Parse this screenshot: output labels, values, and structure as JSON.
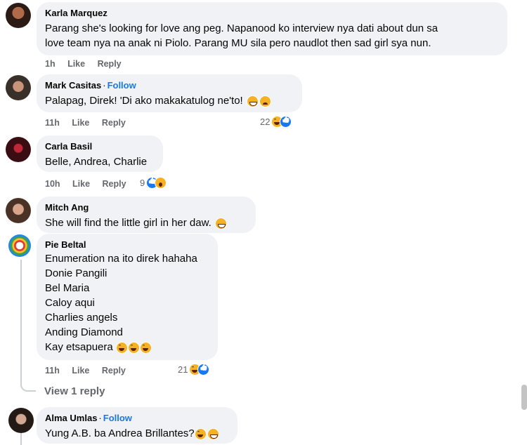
{
  "comments": [
    {
      "author": "Karla Marquez",
      "follow": "",
      "lines": [
        "Parang she's looking for love ang peg. Napanood ko interview nya dati about dun sa",
        "love team nya na anak ni Piolo. Parang MU sila pero naudlot then sad girl sya nun."
      ],
      "time": "1h",
      "like": "Like",
      "reply": "Reply",
      "reaction_count": ""
    },
    {
      "author": "Mark Casitas",
      "follow": "Follow",
      "lines": [
        "Palapag, Direk! 'Di ako makakatulog ne'to!"
      ],
      "time": "11h",
      "like": "Like",
      "reply": "Reply",
      "reaction_count": "22"
    },
    {
      "author": "Carla Basil",
      "follow": "",
      "lines": [
        "Belle, Andrea, Charlie"
      ],
      "time": "10h",
      "like": "Like",
      "reply": "Reply",
      "reaction_count": "9"
    },
    {
      "author": "Mitch Ang",
      "follow": "",
      "lines": [
        "She will find the little girl in her daw."
      ],
      "time": "",
      "like": "",
      "reply": "",
      "reaction_count": ""
    },
    {
      "author": "Pie Beltal",
      "follow": "",
      "lines": [
        "Enumeration na ito direk hahaha",
        "Donie Pangili",
        "Bel Maria",
        "Caloy aqui",
        "Charlies angels",
        "Anding Diamond",
        "Kay etsapuera"
      ],
      "time": "11h",
      "like": "Like",
      "reply": "Reply",
      "reaction_count": "21"
    },
    {
      "author": "Alma Umlas",
      "follow": "Follow",
      "lines": [
        "Yung A.B. ba Andrea Brillantes?"
      ],
      "time": "",
      "like": "",
      "reply": "",
      "reaction_count": ""
    }
  ],
  "view_replies": "View 1 reply",
  "follow_separator": "·",
  "colors": {
    "bubble": "#f0f2f5",
    "follow": "#1877f2",
    "meta": "#65676b",
    "haha": "#f7b125",
    "like": "#1877f2"
  }
}
